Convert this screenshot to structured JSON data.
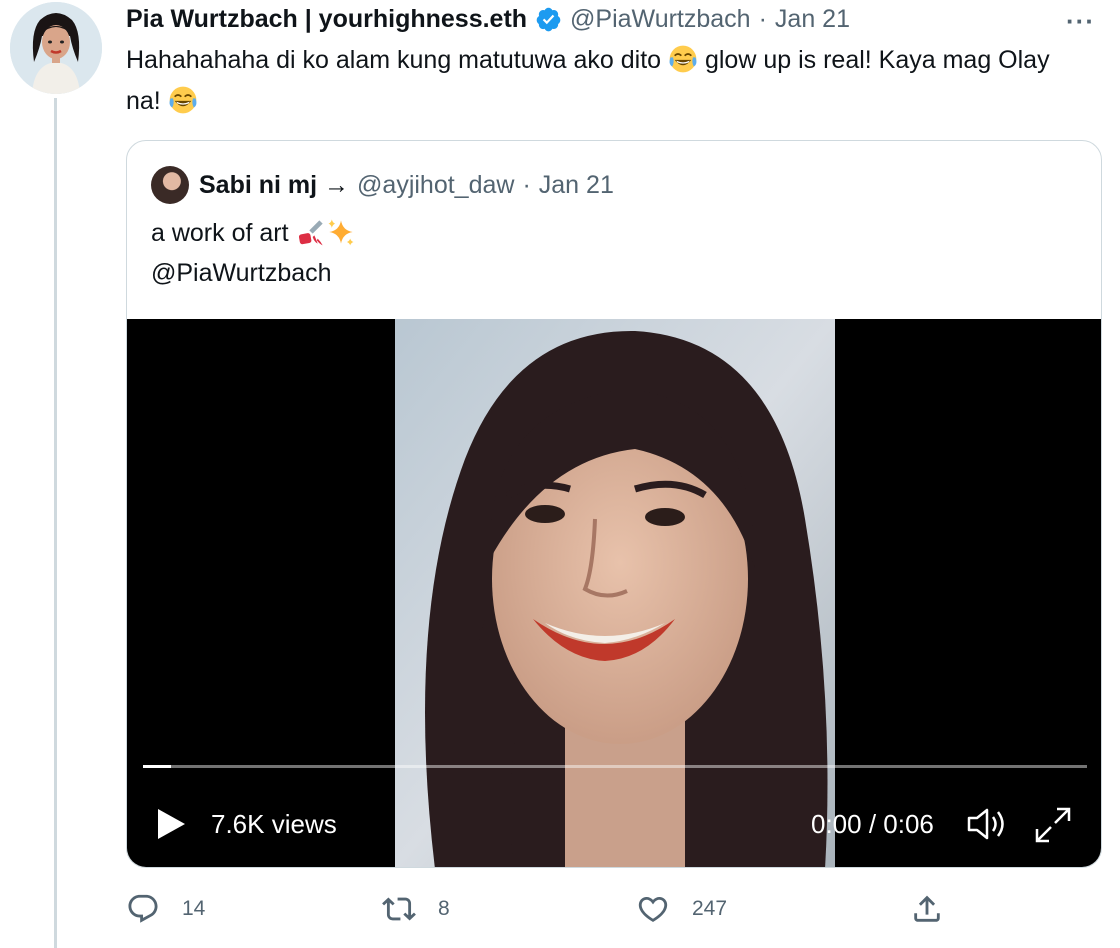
{
  "tweet": {
    "author_name": "Pia Wurtzbach | yourhighness.eth",
    "handle": "@PiaWurtzbach",
    "separator": "·",
    "date": "Jan 21",
    "more_label": "···",
    "text_part1": "Hahahahaha di ko alam kung matutuwa ako dito ",
    "text_part2": " glow up is real! Kaya mag Olay na! ",
    "emoji": "joy-emoji"
  },
  "quote": {
    "author_name": "Sabi ni mj →",
    "handle": "@ayjihot_daw",
    "separator": "·",
    "date": "Jan 21",
    "text_line1": "a work of art ",
    "text_line2": "@PiaWurtzbach",
    "emojis": [
      "nail-polish-emoji",
      "sparkles-emoji"
    ]
  },
  "video": {
    "views": "7.6K views",
    "time": "0:00 / 0:06",
    "progress": 0.03
  },
  "actions": {
    "replies": "14",
    "retweets": "8",
    "likes": "247"
  },
  "colors": {
    "text": "#0f1419",
    "secondary": "#536471",
    "verified": "#1d9bf0",
    "border": "#cfd9de"
  }
}
